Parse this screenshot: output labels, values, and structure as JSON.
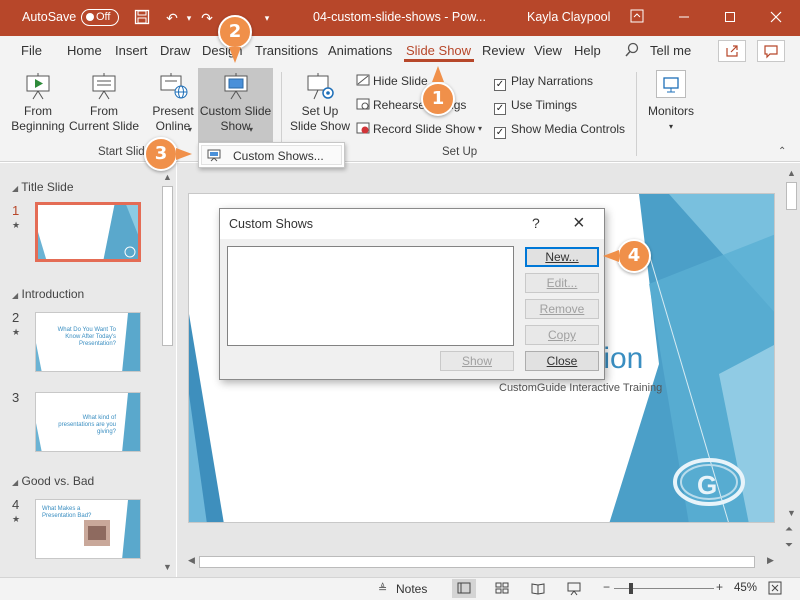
{
  "titlebar": {
    "autosave_label": "AutoSave",
    "autosave_state": "Off",
    "doc_title": "04-custom-slide-shows  -  Pow...",
    "user": "Kayla Claypool",
    "accent": "#b7472a"
  },
  "tabs": [
    "File",
    "Home",
    "Insert",
    "Draw",
    "Design",
    "Transitions",
    "Animations",
    "Slide Show",
    "Review",
    "View",
    "Help"
  ],
  "active_tab": "Slide Show",
  "tell_me": "Tell me",
  "ribbon": {
    "from_beginning": [
      "From",
      "Beginning"
    ],
    "from_current": [
      "From",
      "Current Slide"
    ],
    "present_online": [
      "Present",
      "Online"
    ],
    "custom_slide_show": [
      "Custom Slide",
      "Show"
    ],
    "group_start": "Start Slide",
    "set_up_slide_show": [
      "Set Up",
      "Slide Show"
    ],
    "hide_slide": "Hide Slide",
    "rehearse": "Rehearse",
    "rehearse_tail": "ngs",
    "record": "Record Slide Show",
    "play_narrations": "Play Narrations",
    "use_timings": "Use Timings",
    "show_media": "Show Media Controls",
    "group_setup": "Set Up",
    "monitors": "Monitors"
  },
  "dropdown": {
    "item": "Custom Shows..."
  },
  "slides_panel": {
    "sections": [
      "Title Slide",
      "Introduction",
      "Good vs. Bad"
    ],
    "numbers": [
      "1",
      "2",
      "3",
      "4"
    ],
    "thumb2_text": "What Do You Want To Know After Today's Presentation?",
    "thumb3_text": "What kind of presentations are you giving?",
    "thumb4_text": "What Makes a Presentation Bad?"
  },
  "slide": {
    "title_fragment": "tion",
    "subtitle": "CustomGuide Interactive Training"
  },
  "dialog": {
    "title": "Custom Shows",
    "help": "?",
    "close": "×",
    "new": "New...",
    "edit": "Edit...",
    "remove": "Remove",
    "copy": "Copy",
    "show": "Show",
    "close_btn": "Close"
  },
  "callouts": [
    "1",
    "2",
    "3",
    "4"
  ],
  "status": {
    "notes": "Notes",
    "zoom": "45%"
  }
}
